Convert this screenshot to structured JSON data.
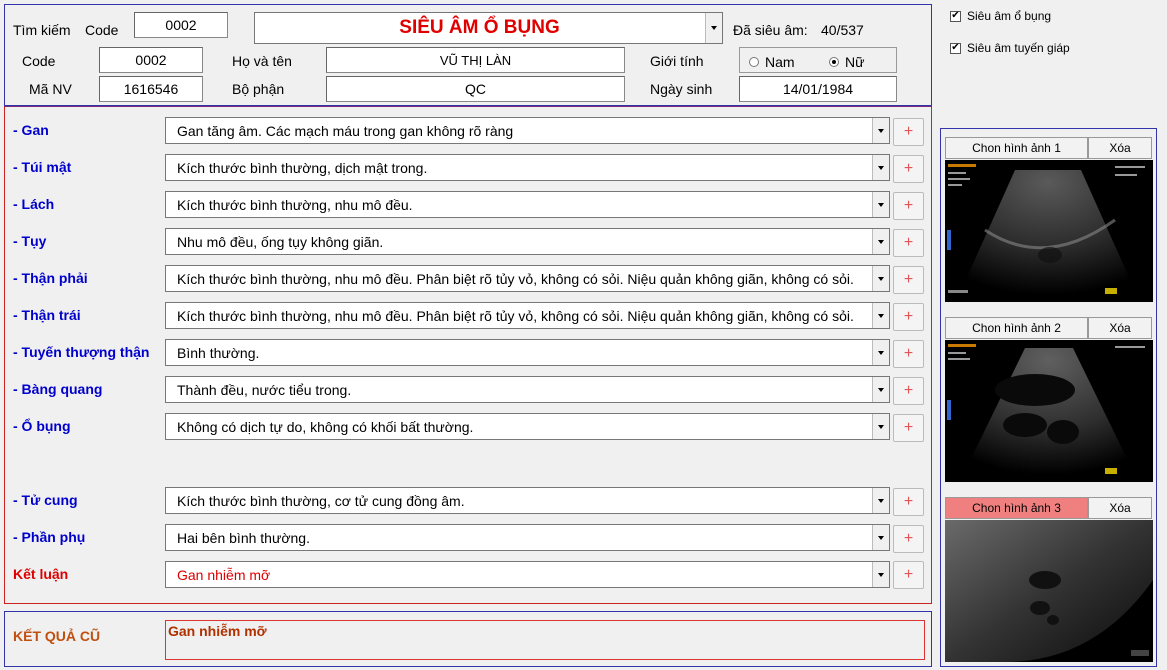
{
  "search": {
    "label": "Tìm kiếm",
    "code_label": "Code",
    "code_value": "0002"
  },
  "exam_type": {
    "selected": "SIÊU ÂM Ổ BỤNG"
  },
  "counter": {
    "label": "Đã siêu âm:",
    "value": "40/537"
  },
  "patient": {
    "code_label": "Code",
    "code_value": "0002",
    "name_label": "Họ và tên",
    "name_value": "VŨ THỊ LÀN",
    "gender_label": "Giới tính",
    "gender_male": "Nam",
    "gender_female": "Nữ",
    "gender_selected": "female",
    "staff_label": "Mã NV",
    "staff_value": "1616546",
    "dept_label": "Bộ phận",
    "dept_value": "QC",
    "dob_label": "Ngày sinh",
    "dob_value": "14/01/1984"
  },
  "options": {
    "abdomen": {
      "label": "Siêu âm ổ bụng",
      "checked": true
    },
    "thyroid": {
      "label": "Siêu âm tuyến giáp",
      "checked": true
    }
  },
  "findings": [
    {
      "label": "- Gan",
      "value": "Gan tăng âm. Các mạch máu trong gan không rõ ràng"
    },
    {
      "label": "- Túi mật",
      "value": "Kích thước bình thường, dịch mật trong."
    },
    {
      "label": "- Lách",
      "value": "Kích thước bình thường, nhu mô đều."
    },
    {
      "label": "- Tụy",
      "value": "Nhu mô đều, ống tụy không giãn."
    },
    {
      "label": "- Thận phải",
      "value": "Kích thước bình thường, nhu mô đều. Phân biệt rõ tủy vỏ, không có sỏi. Niệu quản không giãn, không có sỏi."
    },
    {
      "label": "- Thận trái",
      "value": "Kích thước bình thường, nhu mô đều. Phân biệt rõ tủy vỏ, không có sỏi. Niệu quản không giãn, không có sỏi."
    },
    {
      "label": "- Tuyến thượng thận",
      "value": "Bình thường."
    },
    {
      "label": "- Bàng quang",
      "value": "Thành đều, nước tiểu trong."
    },
    {
      "label": "- Ổ bụng",
      "value": "Không có dịch tự do, không có khối bất thường."
    },
    {
      "label": "- Tử cung",
      "value": "Kích thước bình thường, cơ tử cung đồng âm."
    },
    {
      "label": "- Phần phụ",
      "value": "Hai bên bình thường."
    }
  ],
  "conclusion": {
    "label": "Kết luận",
    "value": "Gan nhiễm mỡ"
  },
  "plus_label": "+",
  "old_result": {
    "label": "KẾT QUẢ CŨ",
    "value": "Gan nhiễm mỡ"
  },
  "images": [
    {
      "choose_label": "Chon hình ảnh 1",
      "delete_label": "Xóa"
    },
    {
      "choose_label": "Chon hình ảnh 2",
      "delete_label": "Xóa"
    },
    {
      "choose_label": "Chon hình ảnh 3",
      "delete_label": "Xóa"
    }
  ],
  "colors": {
    "title_red": "#e00000",
    "label_blue": "#0000cc",
    "label_red": "#dd0000",
    "panel_border_blue": "#3333aa",
    "panel_border_red": "#cc2222",
    "active_button": "#f08080"
  }
}
